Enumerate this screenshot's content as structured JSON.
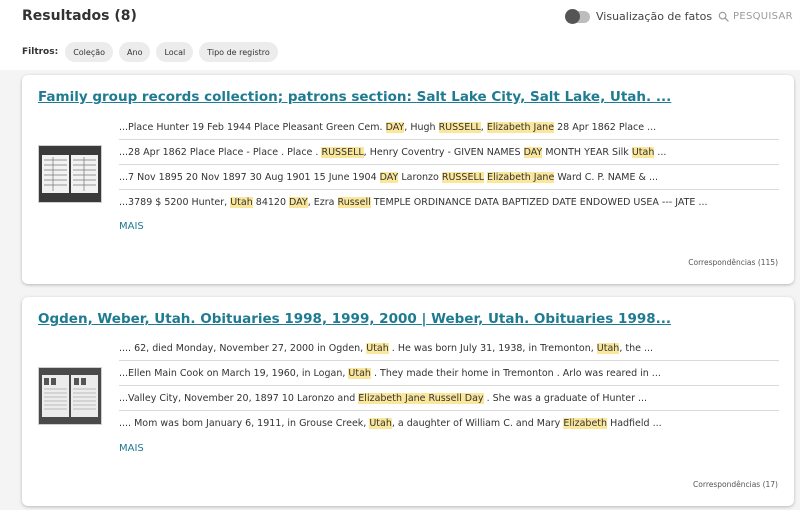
{
  "header": {
    "results_title": "Resultados (8)",
    "facts_toggle_label": "Visualização de fatos",
    "search_label": "PESQUISAR"
  },
  "filters": {
    "label": "Filtros:",
    "chips": [
      "Coleção",
      "Ano",
      "Local",
      "Tipo de registro"
    ]
  },
  "results": [
    {
      "title": "Family group records collection; patrons section: Salt Lake City, Salt Lake, Utah. ...",
      "snippets": [
        [
          "...Place Hunter 19 Feb 1944 Place Pleasant Green Cem. ",
          "DAY",
          ", Hugh ",
          "RUSSELL",
          ", ",
          "Elizabeth Jane",
          " 28 Apr 1862 Place ..."
        ],
        [
          "...28 Apr 1862 Place Place - Place . Place . ",
          "RUSSELL",
          ", Henry Coventry - GIVEN NAMES ",
          "DAY",
          " MONTH YEAR Silk ",
          "Utah",
          " ..."
        ],
        [
          "...7 Nov 1895 20 Nov 1897 30 Aug 1901 15 June 1904 ",
          "DAY",
          " Laronzo ",
          "RUSSELL",
          " ",
          "Elizabeth Jane",
          " Ward C. P. NAME & ..."
        ],
        [
          "...3789 $ 5200 Hunter, ",
          "Utah",
          " 84120 ",
          "DAY",
          ", Ezra ",
          "Russell",
          " TEMPLE ORDINANCE DATA BAPTIZED DATE ENDOWED USEA --- JATE ..."
        ]
      ],
      "more_label": "MAIS",
      "matches_label": "Correspondências (115)"
    },
    {
      "title": "Ogden, Weber, Utah. Obituaries 1998, 1999, 2000 | Weber, Utah. Obituaries 1998...",
      "snippets": [
        [
          ".... 62, died Monday, November 27, 2000 in Ogden, ",
          "Utah",
          " . He was born July 31, 1938, in Tremonton, ",
          "Utah",
          ", the ..."
        ],
        [
          "...Ellen Main Cook on March 19, 1960, in Logan, ",
          "Utah",
          " . They made their home in Tremonton . Arlo was reared in ..."
        ],
        [
          "...Valley City, November 20, 1897 10 Laronzo and ",
          "Elizabeth Jane Russell Day",
          " . She was a graduate of Hunter ..."
        ],
        [
          ".... Mom was bom January 6, 1911, in Grouse Creek, ",
          "Utah",
          ", a daughter of William C. and Mary ",
          "Elizabeth",
          " Hadfield ..."
        ]
      ],
      "more_label": "MAIS",
      "matches_label": "Correspondências (17)"
    }
  ],
  "icons": {
    "search": "search-icon",
    "toggle": "toggle-switch",
    "thumbnail": "document-thumbnail-icon"
  },
  "colors": {
    "link": "#1e7b91",
    "highlight": "#fbe79c",
    "background": "#f4f4f4"
  }
}
